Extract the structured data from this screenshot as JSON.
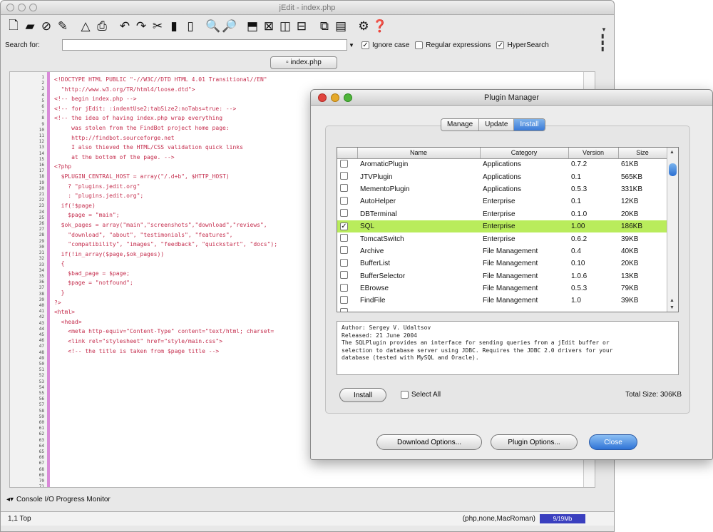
{
  "editor": {
    "title": "jEdit - index.php",
    "search_label": "Search for:",
    "search_value": "",
    "options": [
      {
        "label": "Ignore case",
        "checked": true
      },
      {
        "label": "Regular expressions",
        "checked": false
      },
      {
        "label": "HyperSearch",
        "checked": true
      }
    ],
    "buffer_tab": "index.php",
    "code_lines": [
      "<!DOCTYPE HTML PUBLIC \"-//W3C//DTD HTML 4.01 Transitional//EN\"",
      "  \"http://www.w3.org/TR/html4/loose.dtd\">",
      "",
      "<!-- begin index.php -->",
      "",
      "<!-- for jEdit: :indentUse2:tabSize2:noTabs=true: -->",
      "",
      "<!-- the idea of having index.php wrap everything",
      "     was stolen from the FindBot project home page:",
      "",
      "     http://findbot.sourceforge.net",
      "",
      "     I also thieved the HTML/CSS validation quick links",
      "     at the bottom of the page. -->",
      "",
      "<?php",
      "  $PLUGIN_CENTRAL_HOST = array(\"/.d+b\", $HTTP_HOST)",
      "    ? \"plugins.jedit.org\"",
      "    : \"plugins.jedit.org\";",
      "",
      "  if(!$page)",
      "    $page = \"main\";",
      "",
      "  $ok_pages = array(\"main\",\"screenshots\",\"download\",\"reviews\",",
      "    \"download\", \"about\", \"testimonials\", \"features\",",
      "    \"compatibility\", \"images\", \"feedback\", \"quickstart\", \"docs\");",
      "",
      "  if(!in_array($page,$ok_pages))",
      "  {",
      "    $bad_page = $page;",
      "    $page = \"notfound\";",
      "  }",
      "?>",
      "",
      "<html>",
      "  <head>",
      "    <meta http-equiv=\"Content-Type\" content=\"text/html; charset=",
      "",
      "    <link rel=\"stylesheet\" href=\"style/main.css\">",
      "",
      "    <!-- the title is taken from $page title -->"
    ],
    "console_label": "Console I/O Progress Monitor",
    "status_left": "1,1 Top",
    "status_right": "(php,none,MacRoman)",
    "status_memory": "9/19Mb"
  },
  "plugin_manager": {
    "title": "Plugin Manager",
    "tabs": [
      {
        "label": "Manage",
        "active": false
      },
      {
        "label": "Update",
        "active": false
      },
      {
        "label": "Install",
        "active": true
      }
    ],
    "columns": [
      "",
      "Name",
      "Category",
      "Version",
      "Size"
    ],
    "plugins": [
      {
        "checked": false,
        "name": "AromaticPlugin",
        "category": "Applications",
        "version": "0.7.2",
        "size": "61KB",
        "selected": false
      },
      {
        "checked": false,
        "name": "JTVPlugin",
        "category": "Applications",
        "version": "0.1",
        "size": "565KB",
        "selected": false
      },
      {
        "checked": false,
        "name": "MementoPlugin",
        "category": "Applications",
        "version": "0.5.3",
        "size": "331KB",
        "selected": false
      },
      {
        "checked": false,
        "name": "AutoHelper",
        "category": "Enterprise",
        "version": "0.1",
        "size": "12KB",
        "selected": false
      },
      {
        "checked": false,
        "name": "DBTerminal",
        "category": "Enterprise",
        "version": "0.1.0",
        "size": "20KB",
        "selected": false
      },
      {
        "checked": true,
        "name": "SQL",
        "category": "Enterprise",
        "version": "1.00",
        "size": "186KB",
        "selected": true
      },
      {
        "checked": false,
        "name": "TomcatSwitch",
        "category": "Enterprise",
        "version": "0.6.2",
        "size": "39KB",
        "selected": false
      },
      {
        "checked": false,
        "name": "Archive",
        "category": "File Management",
        "version": "0.4",
        "size": "40KB",
        "selected": false
      },
      {
        "checked": false,
        "name": "BufferList",
        "category": "File Management",
        "version": "0.10",
        "size": "20KB",
        "selected": false
      },
      {
        "checked": false,
        "name": "BufferSelector",
        "category": "File Management",
        "version": "1.0.6",
        "size": "13KB",
        "selected": false
      },
      {
        "checked": false,
        "name": "EBrowse",
        "category": "File Management",
        "version": "0.5.3",
        "size": "79KB",
        "selected": false
      },
      {
        "checked": false,
        "name": "FindFile",
        "category": "File Management",
        "version": "1.0",
        "size": "39KB",
        "selected": false
      },
      {
        "checked": false,
        "name": "",
        "category": "",
        "version": "",
        "size": "",
        "selected": false
      }
    ],
    "description_lines": [
      "Author: Sergey V. Udaltsov",
      "Released: 21 June 2004",
      "The SQLPlugin provides an interface for sending queries from a jEdit buffer or",
      "selection to database server using JDBC. Requires the JDBC 2.0 drivers for your",
      "database (tested with MySQL and Oracle)."
    ],
    "install_button": "Install",
    "select_all_label": "Select All",
    "total_size": "Total Size: 306KB",
    "download_options_button": "Download Options...",
    "plugin_options_button": "Plugin Options...",
    "close_button": "Close"
  },
  "colors": {
    "selected_row": "#b9ec5c",
    "active_tab": "#3a7ad8",
    "code_text": "#c52e4e",
    "code_keyword": "#1c3fd1",
    "gutter_marker": "#d98ad9"
  }
}
